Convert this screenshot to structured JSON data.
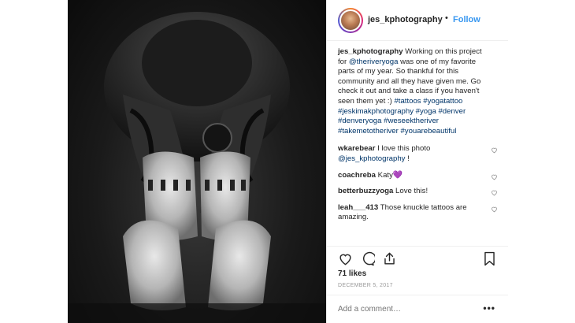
{
  "post": {
    "image_alt": "Black-and-white photo of a tattooed person in a seated forward fold holding their feet"
  },
  "header": {
    "username": "jes_kphotography",
    "separator": "•",
    "follow_label": "Follow"
  },
  "caption": {
    "username": "jes_kphotography",
    "text_before_mention": " Working on this project for ",
    "mention": "@theriveryoga",
    "text_after_mention": " was one of my favorite parts of my year. So thankful for this community and all they have given me. Go check it out and take a class if you haven't seen them yet :) ",
    "hashtags": "#tattoos #yogatattoo #jeskimakphotography #yoga #denver #denveryoga #weseektheriver #takemetotheriver #youarebeautiful"
  },
  "comments": [
    {
      "username": "wkarebear",
      "text": " I love this photo ",
      "mention": "@jes_kphotography",
      "suffix": " !"
    },
    {
      "username": "coachreba",
      "text": " Katy",
      "emoji": "💜"
    },
    {
      "username": "betterbuzzyoga",
      "text": " Love this!"
    },
    {
      "username": "leah___413",
      "text": " Those knuckle tattoos are amazing."
    }
  ],
  "actions": {
    "likes": "71 likes",
    "date": "December 5, 2017"
  },
  "add_comment": {
    "placeholder": "Add a comment…",
    "more_label": "•••"
  },
  "colors": {
    "link_blue": "#3897f0",
    "hashtag_blue": "#003569",
    "muted_gray": "#999999",
    "text": "#262626"
  }
}
